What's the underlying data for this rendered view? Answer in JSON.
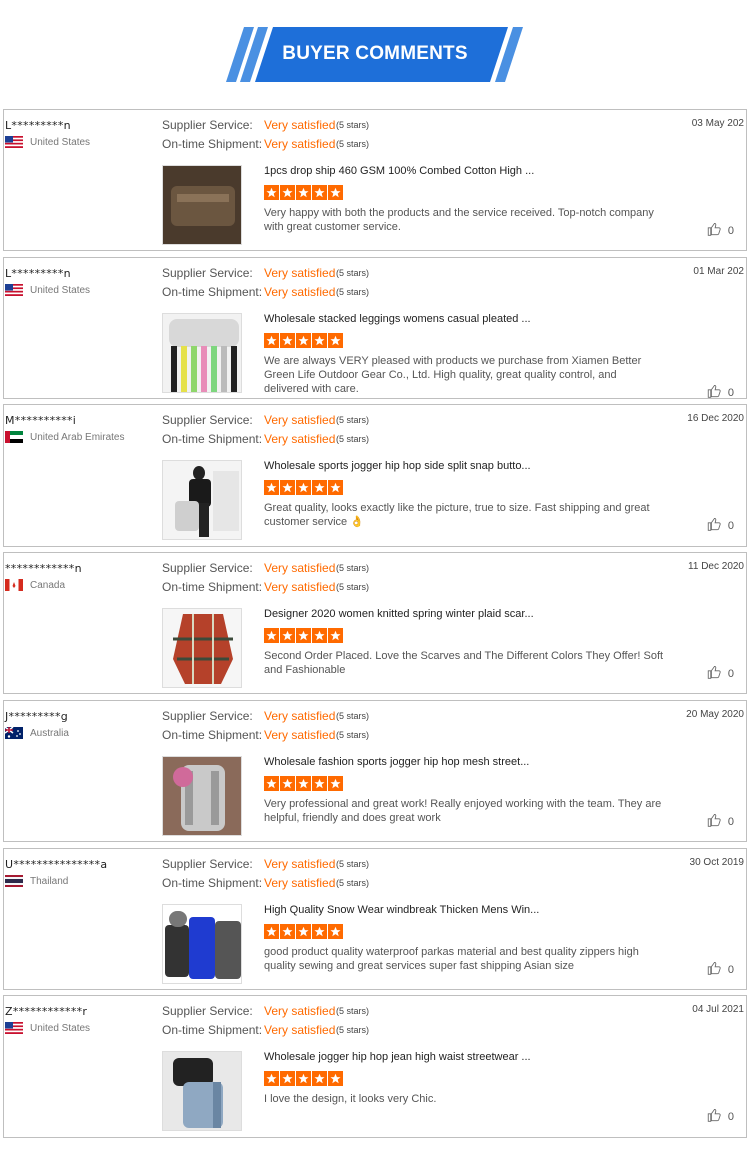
{
  "banner": {
    "title": "BUYER COMMENTS"
  },
  "labels": {
    "supplier_service": "Supplier Service:",
    "on_time_shipment": "On-time Shipment:"
  },
  "reviews": [
    {
      "buyer": "L*********n",
      "country": "United States",
      "flag": "us",
      "supplier_rating": "Very satisfied",
      "supplier_stars": "(5 stars)",
      "shipment_rating": "Very satisfied",
      "shipment_stars": "(5 stars)",
      "date": "03 May 202",
      "product_title": "1pcs drop ship 460 GSM 100% Combed Cotton High ...",
      "stars": 5,
      "comment": "Very happy with both the products and the service received. Top-notch company with great customer service.",
      "helpful_count": "0"
    },
    {
      "buyer": "L*********n",
      "country": "United States",
      "flag": "us",
      "supplier_rating": "Very satisfied",
      "supplier_stars": "(5 stars)",
      "shipment_rating": "Very satisfied",
      "shipment_stars": "(5 stars)",
      "date": "01 Mar 202",
      "product_title": "Wholesale stacked leggings womens casual pleated ...",
      "stars": 5,
      "comment": "We are always VERY pleased with products we purchase from Xiamen Better Green Life Outdoor Gear Co., Ltd. High quality, great quality control, and delivered with care.",
      "helpful_count": "0"
    },
    {
      "buyer": "M**********i",
      "country": "United Arab Emirates",
      "flag": "ae",
      "supplier_rating": "Very satisfied",
      "supplier_stars": "(5 stars)",
      "shipment_rating": "Very satisfied",
      "shipment_stars": "(5 stars)",
      "date": "16 Dec 2020",
      "product_title": "Wholesale sports jogger hip hop side split snap butto...",
      "stars": 5,
      "comment": "Great quality, looks exactly like the picture, true to size. Fast shipping and great customer service 👌",
      "helpful_count": "0"
    },
    {
      "buyer": "************n",
      "country": "Canada",
      "flag": "ca",
      "supplier_rating": "Very satisfied",
      "supplier_stars": "(5 stars)",
      "shipment_rating": "Very satisfied",
      "shipment_stars": "(5 stars)",
      "date": "11 Dec 2020",
      "product_title": "Designer 2020 women knitted spring winter plaid scar...",
      "stars": 5,
      "comment": "Second Order Placed. Love the Scarves and The Different Colors They Offer! Soft and Fashionable",
      "helpful_count": "0"
    },
    {
      "buyer": "J*********g",
      "country": "Australia",
      "flag": "au",
      "supplier_rating": "Very satisfied",
      "supplier_stars": "(5 stars)",
      "shipment_rating": "Very satisfied",
      "shipment_stars": "(5 stars)",
      "date": "20 May 2020",
      "product_title": "Wholesale fashion sports jogger hip hop mesh street...",
      "stars": 5,
      "comment": "Very professional and great work! Really enjoyed working with the team. They are helpful, friendly and does great work",
      "helpful_count": "0"
    },
    {
      "buyer": "U***************a",
      "country": "Thailand",
      "flag": "th",
      "supplier_rating": "Very satisfied",
      "supplier_stars": "(5 stars)",
      "shipment_rating": "Very satisfied",
      "shipment_stars": "(5 stars)",
      "date": "30 Oct 2019",
      "product_title": "High Quality Snow Wear windbreak Thicken Mens Win...",
      "stars": 5,
      "comment": "good product quality waterproof parkas material and best quality zippers high quality sewing and great services super fast shipping Asian size",
      "helpful_count": "0"
    },
    {
      "buyer": "Z************r",
      "country": "United States",
      "flag": "us",
      "supplier_rating": "Very satisfied",
      "supplier_stars": "(5 stars)",
      "shipment_rating": "Very satisfied",
      "shipment_stars": "(5 stars)",
      "date": "04 Jul 2021",
      "product_title": "Wholesale jogger hip hop jean high waist streetwear ...",
      "stars": 5,
      "comment": "I love the design, it looks very Chic.",
      "helpful_count": "0"
    }
  ],
  "colors": {
    "accent": "#ff6a00",
    "banner_blue": "#1e6fd9",
    "banner_light": "#4a90e2"
  },
  "icons": {
    "star": "star-icon",
    "helpful": "thumbs-up-icon"
  }
}
